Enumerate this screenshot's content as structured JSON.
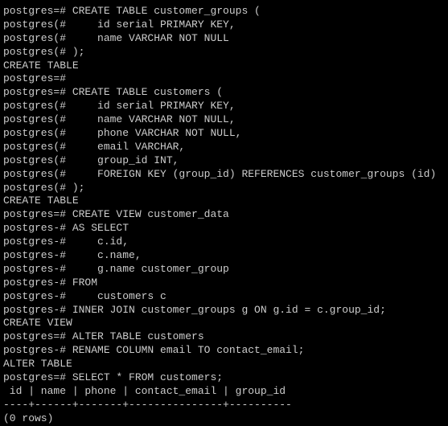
{
  "lines": [
    {
      "text": "postgres=# CREATE TABLE customer_groups ("
    },
    {
      "text": "postgres(#     id serial PRIMARY KEY,"
    },
    {
      "text": "postgres(#     name VARCHAR NOT NULL"
    },
    {
      "text": "postgres(# );"
    },
    {
      "text": "CREATE TABLE"
    },
    {
      "text": "postgres=#"
    },
    {
      "text": "postgres=# CREATE TABLE customers ("
    },
    {
      "text": "postgres(#     id serial PRIMARY KEY,"
    },
    {
      "text": "postgres(#     name VARCHAR NOT NULL,"
    },
    {
      "text": "postgres(#     phone VARCHAR NOT NULL,"
    },
    {
      "text": "postgres(#     email VARCHAR,"
    },
    {
      "text": "postgres(#     group_id INT,"
    },
    {
      "text": "postgres(#     FOREIGN KEY (group_id) REFERENCES customer_groups (id)"
    },
    {
      "text": "postgres(# );"
    },
    {
      "text": "CREATE TABLE"
    },
    {
      "text": "postgres=# CREATE VIEW customer_data"
    },
    {
      "text": "postgres-# AS SELECT"
    },
    {
      "text": "postgres-#     c.id,"
    },
    {
      "text": "postgres-#     c.name,"
    },
    {
      "text": "postgres-#     g.name customer_group"
    },
    {
      "text": "postgres-# FROM"
    },
    {
      "text": "postgres-#     customers c"
    },
    {
      "text": "postgres-# INNER JOIN customer_groups g ON g.id = c.group_id;"
    },
    {
      "text": "CREATE VIEW"
    },
    {
      "text": "postgres=# ALTER TABLE customers"
    },
    {
      "text": "postgres-# RENAME COLUMN email TO contact_email;"
    },
    {
      "text": "ALTER TABLE"
    },
    {
      "text": "postgres=# SELECT * FROM customers;"
    },
    {
      "text": " id | name | phone | contact_email | group_id"
    },
    {
      "text": "----+------+-------+---------------+----------"
    },
    {
      "text": "(0 rows)"
    }
  ]
}
